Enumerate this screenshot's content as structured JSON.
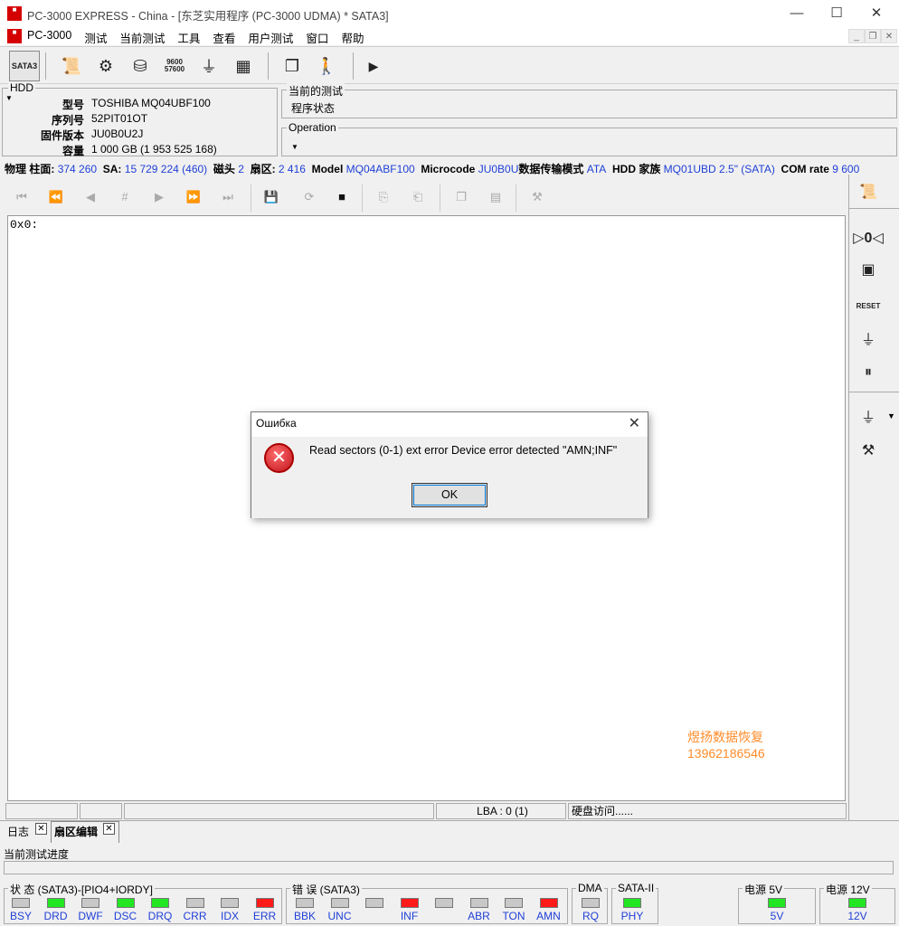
{
  "titlebar": {
    "title": "PC-3000 EXPRESS - China - [东芝实用程序 (PC-3000 UDMA) * SATA3]",
    "minimize": "—",
    "maximize": "☐",
    "close": "✕"
  },
  "menu": {
    "items": [
      "PC-3000",
      "测试",
      "当前测试",
      "工具",
      "查看",
      "用户测试",
      "窗口",
      "帮助"
    ]
  },
  "toolbar": {
    "sata_label": "SATA3"
  },
  "hdd": {
    "group_label": "HDD",
    "model_label": "型号",
    "model": "TOSHIBA MQ04UBF100",
    "serial_label": "序列号",
    "serial": "52PIT01OT",
    "firmware_label": "固件版本",
    "firmware": "JU0B0U2J",
    "capacity_label": "容量",
    "capacity": "1 000 GB (1 953 525 168)"
  },
  "current_test": {
    "group_label": "当前的测试",
    "value": "程序状态"
  },
  "operation": {
    "group_label": "Operation"
  },
  "infoline": {
    "phys_label": "物理 柱面:",
    "phys": "374 260",
    "sa_label": "SA:",
    "sa": "15 729 224 (460)",
    "heads_label": "磁头",
    "heads": "2",
    "zones_label": "扇区:",
    "zones": "2 416",
    "model_label": "Model",
    "model": "MQ04ABF100",
    "micro_label": "Microcode",
    "micro": "JU0B0U",
    "mode_label": "数据传输模式",
    "mode": "ATA",
    "family_label": "HDD 家族",
    "family": "MQ01UBD 2.5\" (SATA)",
    "com_label": "COM rate",
    "com": "9 600"
  },
  "editor": {
    "content": "0x0:"
  },
  "watermark": {
    "line1": "煜扬数据恢复",
    "line2": "13962186546"
  },
  "editor_status": {
    "lba": "LBA : 0 (1)",
    "access": "硬盘访问......"
  },
  "dialog": {
    "title": "Ошибка",
    "close": "✕",
    "message": "Read sectors (0-1) ext error Device error detected \"AMN;INF\"",
    "ok": "OK"
  },
  "tabs": [
    {
      "label": "日志"
    },
    {
      "label": "扇区编辑"
    }
  ],
  "progress": {
    "label": "当前测试进度"
  },
  "status_panel": {
    "label": "状 态 (SATA3)-[PIO4+IORDY]",
    "leds": [
      {
        "name": "BSY",
        "color": "#c8c8c8"
      },
      {
        "name": "DRD",
        "color": "#22e622"
      },
      {
        "name": "DWF",
        "color": "#c8c8c8"
      },
      {
        "name": "DSC",
        "color": "#22e622"
      },
      {
        "name": "DRQ",
        "color": "#22e622"
      },
      {
        "name": "CRR",
        "color": "#c8c8c8"
      },
      {
        "name": "IDX",
        "color": "#c8c8c8"
      },
      {
        "name": "ERR",
        "color": "#ff1a1a"
      }
    ]
  },
  "error_panel": {
    "label": "错 误 (SATA3)",
    "leds": [
      {
        "name": "BBK",
        "color": "#c8c8c8"
      },
      {
        "name": "UNC",
        "color": "#c8c8c8"
      },
      {
        "name": "",
        "color": "#c8c8c8"
      },
      {
        "name": "INF",
        "color": "#ff1a1a"
      },
      {
        "name": "",
        "color": "#c8c8c8"
      },
      {
        "name": "ABR",
        "color": "#c8c8c8"
      },
      {
        "name": "TON",
        "color": "#c8c8c8"
      },
      {
        "name": "AMN",
        "color": "#ff1a1a"
      }
    ]
  },
  "dma_panel": {
    "label": "DMA",
    "led": "RQ",
    "color": "#c8c8c8"
  },
  "sata_panel": {
    "label": "SATA-II",
    "led": "PHY",
    "color": "#22e622"
  },
  "power5_panel": {
    "label": "电源 5V",
    "led": "5V",
    "color": "#22e622"
  },
  "power12_panel": {
    "label": "电源 12V",
    "led": "12V",
    "color": "#22e622"
  }
}
